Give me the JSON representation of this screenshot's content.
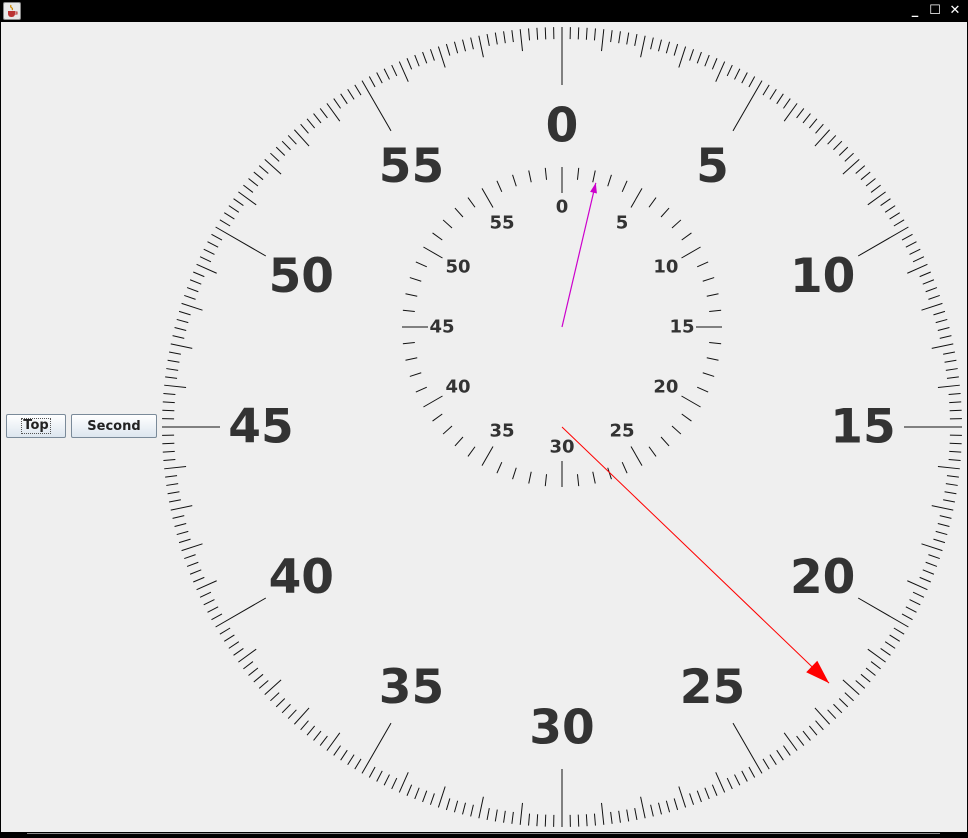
{
  "window": {
    "controls": {
      "minimize": "_",
      "maximize": "☐",
      "close": "✕"
    },
    "icon": "java-cup-icon"
  },
  "buttons": {
    "top_label": "Top",
    "second_label": "Second"
  },
  "dial": {
    "outer_labels": [
      "0",
      "5",
      "10",
      "15",
      "20",
      "25",
      "30",
      "35",
      "40",
      "45",
      "50",
      "55"
    ],
    "inner_labels": [
      "0",
      "5",
      "10",
      "15",
      "20",
      "25",
      "30",
      "35",
      "40",
      "45",
      "50",
      "55"
    ],
    "outer_hand_value": 22.3,
    "inner_hand_value": 2.2,
    "colors": {
      "outer_hand": "#ff0000",
      "inner_hand": "#cc00cc",
      "ticks": "#111111",
      "labels": "#333333",
      "background": "#efefef"
    }
  }
}
